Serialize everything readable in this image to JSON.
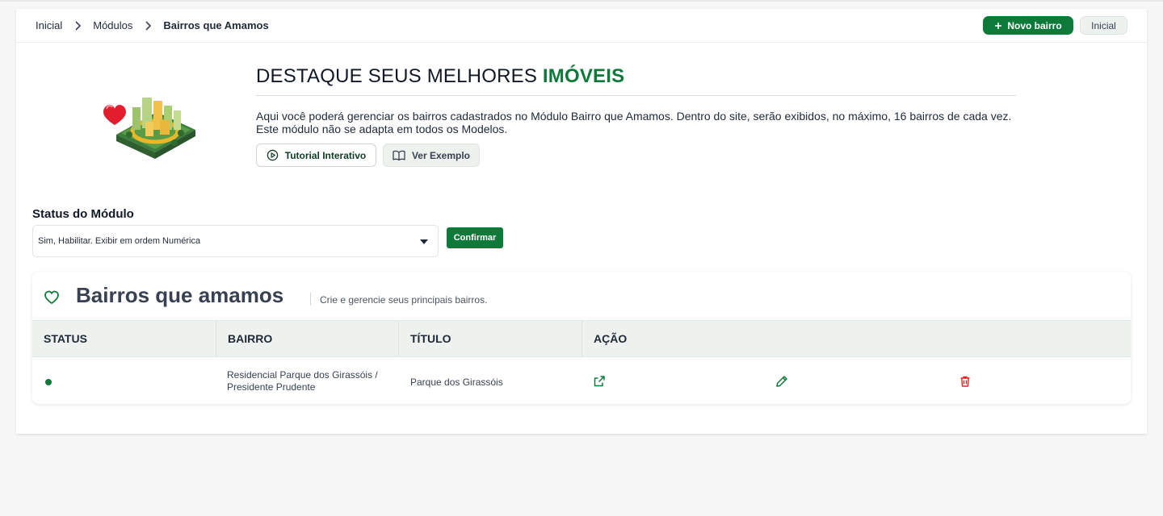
{
  "breadcrumb": {
    "items": [
      "Inicial",
      "Módulos"
    ],
    "current": "Bairros que Amamos"
  },
  "header_actions": {
    "new_label": "Novo bairro",
    "home_label": "Inicial"
  },
  "hero": {
    "title_prefix": "DESTAQUE SEUS MELHORES",
    "title_accent": "IMÓVEIS",
    "description": "Aqui você poderá gerenciar os bairros cadastrados no Módulo Bairro que Amamos. Dentro do site, serão exibidos, no máximo, 16 bairros de cada vez. Este módulo não se adapta em todos os Modelos.",
    "tutorial_label": "Tutorial Interativo",
    "example_label": "Ver Exemplo"
  },
  "status_module": {
    "label": "Status do Módulo",
    "selected": "Sim, Habilitar. Exibir em ordem Numérica",
    "confirm_label": "Confirmar"
  },
  "list": {
    "title": "Bairros que amamos",
    "subtitle": "Crie e gerencie seus principais bairros.",
    "columns": [
      "STATUS",
      "BAIRRO",
      "TÍTULO",
      "AÇÃO"
    ],
    "rows": [
      {
        "status": "active",
        "bairro": "Residencial Parque dos Girassóis / Presidente Prudente",
        "titulo": "Parque dos Girassóis"
      }
    ]
  },
  "colors": {
    "brand": "#0e7a3a",
    "danger": "#dc2626",
    "header_bg": "#eef2ef"
  },
  "icons": {
    "breadcrumb_sep": "chevron-right-icon",
    "new": "plus-icon",
    "tutorial": "play-circle-icon",
    "example": "book-open-icon",
    "select": "caret-down-icon",
    "list": "heart-icon",
    "open": "external-link-icon",
    "edit": "pencil-icon",
    "delete": "trash-icon"
  }
}
